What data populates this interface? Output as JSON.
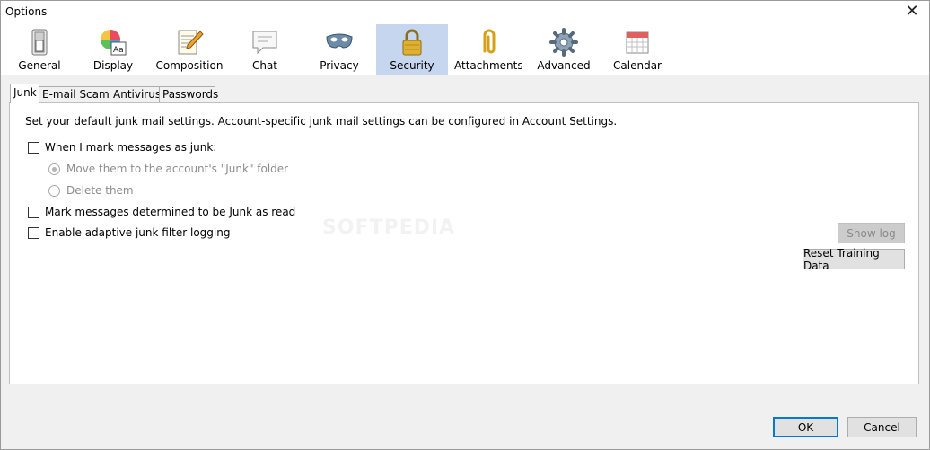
{
  "window": {
    "title": "Options",
    "close_glyph": "✕"
  },
  "toolbar": {
    "panes": [
      {
        "label": "General",
        "icon": "switch-icon"
      },
      {
        "label": "Display",
        "icon": "palette-icon"
      },
      {
        "label": "Composition",
        "icon": "notepad-pencil-icon"
      },
      {
        "label": "Chat",
        "icon": "speech-bubble-icon"
      },
      {
        "label": "Privacy",
        "icon": "mask-icon"
      },
      {
        "label": "Security",
        "icon": "padlock-icon",
        "selected": true
      },
      {
        "label": "Attachments",
        "icon": "paperclip-icon"
      },
      {
        "label": "Advanced",
        "icon": "gear-icon"
      },
      {
        "label": "Calendar",
        "icon": "calendar-icon"
      }
    ],
    "selected_color": "#c5d6ee"
  },
  "tabs": [
    {
      "label": "Junk",
      "active": true
    },
    {
      "label": "E-mail Scams"
    },
    {
      "label": "Antivirus"
    },
    {
      "label": "Passwords"
    }
  ],
  "junk": {
    "intro": "Set your default junk mail settings. Account-specific junk mail settings can be configured in Account Settings.",
    "mark_as_junk": {
      "label": "When I mark messages as junk:",
      "checked": false
    },
    "move_option": {
      "label": "Move them to the account's \"Junk\" folder",
      "checked": true,
      "disabled": true
    },
    "delete_option": {
      "label": "Delete them",
      "checked": false,
      "disabled": true
    },
    "mark_read": {
      "label": "Mark messages determined to be Junk as read",
      "checked": false
    },
    "adaptive_logging": {
      "label": "Enable adaptive junk filter logging",
      "checked": false
    },
    "show_log_label": "Show log",
    "reset_training_label": "Reset Training Data"
  },
  "footer": {
    "ok_label": "OK",
    "cancel_label": "Cancel"
  },
  "watermark": "SOFTPEDIA"
}
